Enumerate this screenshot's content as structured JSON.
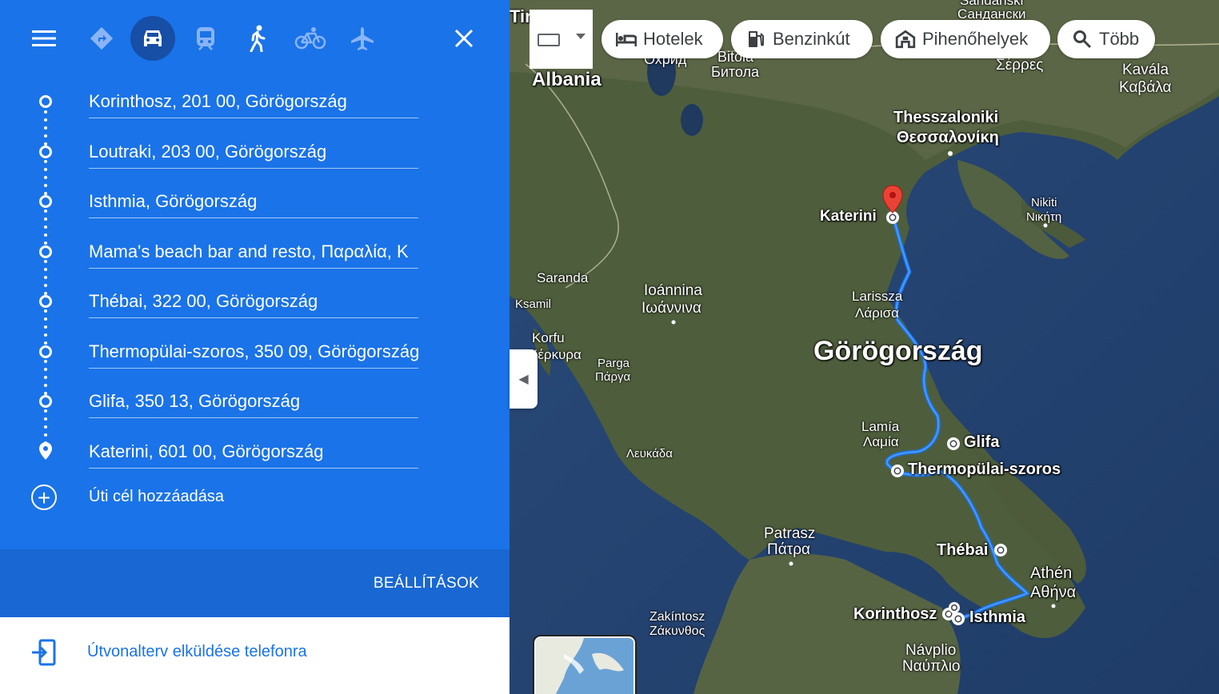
{
  "topbar": {
    "menu_icon": "menu-icon",
    "modes": [
      "best-route-icon",
      "car-icon",
      "train-icon",
      "walk-icon",
      "bike-icon",
      "plane-icon"
    ],
    "close_icon": "close-icon"
  },
  "stops": [
    "Korinthosz, 201 00, Görögország",
    "Loutraki, 203 00, Görögország",
    "Isthmia, Görögország",
    "Mama's beach bar and resto, Παραλία, Κ",
    "Thébai, 322 00, Görögország",
    "Thermopülai-szoros, 350 09, Görögország",
    "Glifa, 350 13, Görögország",
    "Katerini, 601 00, Görögország"
  ],
  "add_destination": "Úti cél hozzáadása",
  "settings_label": "BEÁLLÍTÁSOK",
  "send_to_phone": "Útvonalterv elküldése telefonra",
  "chips": {
    "hotels": "Hotelek",
    "gas": "Benzinkút",
    "rest": "Pihenőhelyek",
    "more": "Több"
  },
  "map_labels": {
    "albania": "Albania",
    "greece": "Görögország",
    "thessaloniki": "Thesszaloniki",
    "thessaloniki_gr": "Θεσσαλονίκη",
    "katerini": "Katerini",
    "larissa": "Larissza",
    "larissa_gr": "Λάρισα",
    "saranda": "Saranda",
    "ksamil": "Ksamil",
    "korfu": "Korfu",
    "korfu_gr": "Κέρκυρα",
    "ioannina": "Ioánnina",
    "ioannina_gr": "Ιωάννινα",
    "parga": "Parga",
    "parga_gr": "Πάργα",
    "lefkada_gr": "Λευκάδα",
    "lamia": "Lamía",
    "lamia_gr": "Λαμία",
    "glifa": "Glifa",
    "thermopylae": "Thermopülai-szoros",
    "patra": "Patrasz",
    "patra_gr": "Πάτρα",
    "thebes": "Thébai",
    "athens": "Athén",
    "athens_gr": "Αθήνα",
    "korinthos": "Korinthosz",
    "isthmia": "Isthmia",
    "zakynthos": "Zakíntosz",
    "zakynthos_gr": "Ζάκυνθος",
    "nafplio": "Návplio",
    "nafplio_gr": "Ναύπλιο",
    "nikiti": "Nikiti",
    "nikiti_gr": "Νικήτη",
    "kavala": "Kavála",
    "kavala_gr": "Καβάλα",
    "serres_gr": "Σέρρες",
    "bitola": "Bitola",
    "bitola_gr": "Битола",
    "sandanski": "Sandanski",
    "sandanski_cyr": "Сандански",
    "ohrid_cyr": "Охрид",
    "tirana_partial": "Tir"
  }
}
